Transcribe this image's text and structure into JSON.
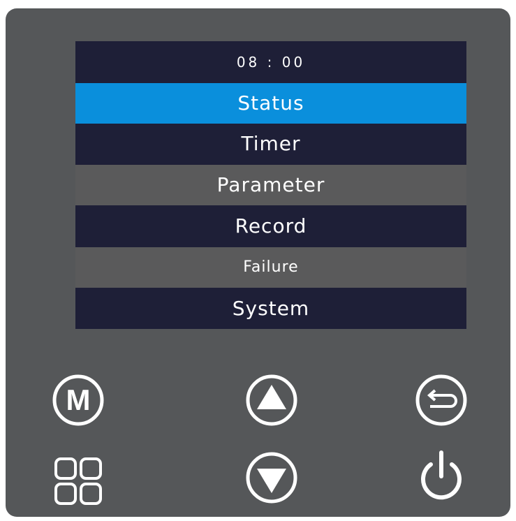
{
  "screen": {
    "clock": "08 : 00",
    "menu": [
      {
        "label": "Status",
        "state": "selected",
        "color": "#0a8fdc"
      },
      {
        "label": "Timer",
        "state": "normal",
        "color": "#1e1f37"
      },
      {
        "label": "Parameter",
        "state": "disabled",
        "color": "#5a5a5b"
      },
      {
        "label": "Record",
        "state": "normal",
        "color": "#1e1f37"
      },
      {
        "label": "Failure",
        "state": "disabled",
        "color": "#5a5a5b"
      },
      {
        "label": "System",
        "state": "normal",
        "color": "#1e1f37"
      }
    ]
  },
  "buttons": {
    "mode": {
      "icon": "circle-m-icon",
      "text": "M"
    },
    "up": {
      "icon": "circle-up-triangle-icon"
    },
    "back": {
      "icon": "circle-return-arrow-icon"
    },
    "grid": {
      "icon": "four-squares-grid-icon"
    },
    "down": {
      "icon": "circle-down-triangle-icon"
    },
    "power": {
      "icon": "power-icon"
    }
  },
  "colors": {
    "panel": "#555759",
    "screen": "#1e1f37",
    "highlight": "#0a8fdc",
    "disabled_row": "#5a5a5b",
    "icon": "#ffffff"
  }
}
